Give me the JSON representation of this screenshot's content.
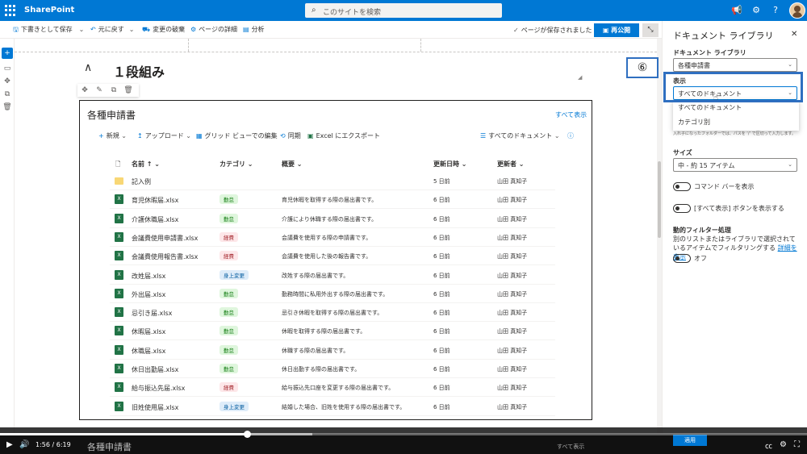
{
  "suitebar": {
    "app_name": "SharePoint",
    "search_placeholder": "このサイトを検索",
    "icons": [
      "megaphone-icon",
      "gear-icon",
      "help-icon",
      "avatar"
    ]
  },
  "command_bar": {
    "save_draft": "下書きとして保存",
    "undo": "元に戻す",
    "discard": "変更の破棄",
    "page_details": "ページの詳細",
    "analytics": "分析",
    "saved_message": "ページが保存されました",
    "republish": "再公開"
  },
  "section": {
    "title": "１段組み"
  },
  "webpart": {
    "title": "各種申請書",
    "see_all": "すべて表示",
    "commands": {
      "new": "新規",
      "upload": "アップロード",
      "grid_edit": "グリッド ビューでの編集",
      "sync": "同期",
      "export_excel": "Excel にエクスポート",
      "view": "すべてのドキュメント"
    },
    "columns": {
      "name": "名前",
      "category": "カテゴリ",
      "description": "概要",
      "modified": "更新日時",
      "modified_by": "更新者"
    },
    "rows": [
      {
        "type": "folder",
        "name": "記入例",
        "category": "",
        "cat_color": "",
        "description": "",
        "modified": "5 日前",
        "modified_by": "山田 真知子"
      },
      {
        "type": "xlsx",
        "name": "育児休暇届.xlsx",
        "category": "勤怠",
        "cat_color": "green",
        "description": "育児休暇を取得する際の届出書です。",
        "modified": "6 日前",
        "modified_by": "山田 真知子"
      },
      {
        "type": "xlsx",
        "name": "介護休職届.xlsx",
        "category": "勤怠",
        "cat_color": "green",
        "description": "介護により休職する際の届出書です。",
        "modified": "6 日前",
        "modified_by": "山田 真知子"
      },
      {
        "type": "xlsx",
        "name": "会議費使用申請書.xlsx",
        "category": "経費",
        "cat_color": "red",
        "description": "会議費を使用する際の申請書です。",
        "modified": "6 日前",
        "modified_by": "山田 真知子"
      },
      {
        "type": "xlsx",
        "name": "会議費使用報告書.xlsx",
        "category": "経費",
        "cat_color": "red",
        "description": "会議費を使用した後の報告書です。",
        "modified": "6 日前",
        "modified_by": "山田 真知子"
      },
      {
        "type": "xlsx",
        "name": "改姓届.xlsx",
        "category": "身上変更",
        "cat_color": "blue",
        "description": "改姓する際の届出書です。",
        "modified": "6 日前",
        "modified_by": "山田 真知子"
      },
      {
        "type": "xlsx",
        "name": "外出届.xlsx",
        "category": "勤怠",
        "cat_color": "green",
        "description": "勤務時間に私用外出する際の届出書です。",
        "modified": "6 日前",
        "modified_by": "山田 真知子"
      },
      {
        "type": "xlsx",
        "name": "忌引き届.xlsx",
        "category": "勤怠",
        "cat_color": "green",
        "description": "忌引き休暇を取得する際の届出書です。",
        "modified": "6 日前",
        "modified_by": "山田 真知子"
      },
      {
        "type": "xlsx",
        "name": "休暇届.xlsx",
        "category": "勤怠",
        "cat_color": "green",
        "description": "休暇を取得する際の届出書です。",
        "modified": "6 日前",
        "modified_by": "山田 真知子"
      },
      {
        "type": "xlsx",
        "name": "休職届.xlsx",
        "category": "勤怠",
        "cat_color": "green",
        "description": "休職する際の届出書です。",
        "modified": "6 日前",
        "modified_by": "山田 真知子"
      },
      {
        "type": "xlsx",
        "name": "休日出勤届.xlsx",
        "category": "勤怠",
        "cat_color": "green",
        "description": "休日出勤する際の届出書です。",
        "modified": "6 日前",
        "modified_by": "山田 真知子"
      },
      {
        "type": "xlsx",
        "name": "給与振込先届.xlsx",
        "category": "経費",
        "cat_color": "red",
        "description": "給与振込先口座を変更する際の届出書です。",
        "modified": "6 日前",
        "modified_by": "山田 真知子"
      },
      {
        "type": "xlsx",
        "name": "旧姓使用届.xlsx",
        "category": "身上変更",
        "cat_color": "blue",
        "description": "結婚した場合、旧姓を使用する際の届出書です。",
        "modified": "6 日前",
        "modified_by": "山田 真知子"
      }
    ]
  },
  "panel": {
    "title": "ドキュメント ライブラリ",
    "library_label": "ドキュメント ライブラリ",
    "library_value": "各種申請書",
    "view_label": "表示",
    "view_value": "すべてのドキュメント",
    "view_options": [
      "すべてのドキュメント",
      "カテゴリ別"
    ],
    "hint": "入れ子になったフォルダーでは、パスを ‘/’ で区切って入力します。",
    "size_label": "サイズ",
    "size_value": "中 - 約 15 アイテム",
    "toggle_command_bar": "コマンド バーを表示",
    "toggle_see_all": "[すべて表示] ボタンを表示する",
    "dynamic_filter_label": "動的フィルター処理",
    "dynamic_filter_desc": "別のリストまたはライブラリで選択されているアイテムでフィルタリングする",
    "details_link": "詳細を表示",
    "toggle_off": "オフ",
    "apply": "適用"
  },
  "annotation": {
    "step": "⑥"
  },
  "video": {
    "time": "1:56 / 6:19",
    "progress": 0.307
  }
}
